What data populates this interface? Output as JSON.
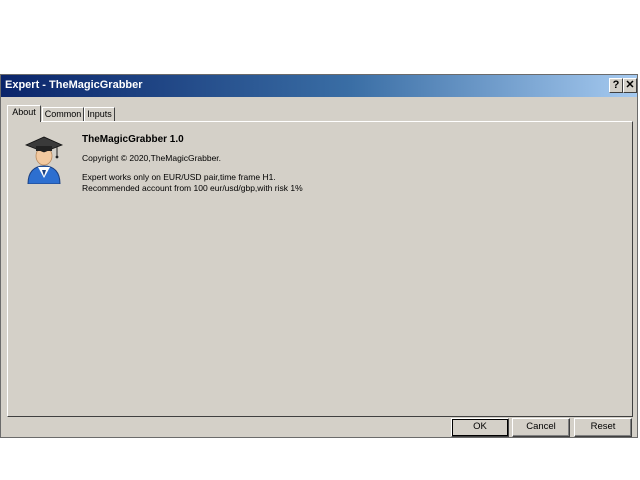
{
  "window": {
    "title": "Expert - TheMagicGrabber",
    "help_label": "?",
    "close_label": "✕"
  },
  "tabs": [
    {
      "label": "About",
      "active": true
    },
    {
      "label": "Common",
      "active": false
    },
    {
      "label": "Inputs",
      "active": false
    }
  ],
  "about": {
    "icon": "graduate-avatar-icon",
    "name": "TheMagicGrabber 1.0",
    "copyright": "Copyright © 2020,TheMagicGrabber.",
    "description_line1": "Expert works only on EUR/USD pair,time frame H1.",
    "description_line2": "Recommended account from 100 eur/usd/gbp,with risk 1%"
  },
  "buttons": {
    "ok": "OK",
    "cancel": "Cancel",
    "reset": "Reset"
  },
  "colors": {
    "dialog_bg": "#d4d0c8",
    "title_gradient_start": "#0a246a",
    "title_gradient_end": "#a6caf0",
    "title_text": "#ffffff"
  }
}
